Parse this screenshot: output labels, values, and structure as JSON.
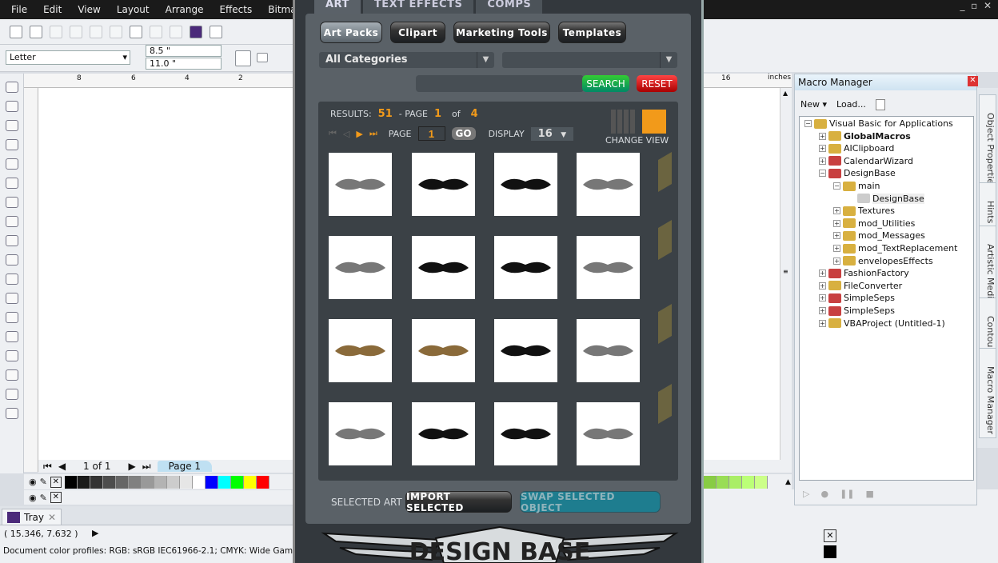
{
  "app": {
    "menu": [
      "File",
      "Edit",
      "View",
      "Layout",
      "Arrange",
      "Effects",
      "Bitmaps"
    ],
    "paper_size": "Letter",
    "width": "8.5 \"",
    "height": "11.0 \"",
    "ruler_ticks": [
      "8",
      "6",
      "4",
      "2"
    ],
    "ruler_ticks_right": [
      "16"
    ],
    "ruler_unit": "inches",
    "page_counter": "1 of 1",
    "page_tab": "Page 1",
    "tray_label": "Tray",
    "coordinates": "( 15.346, 7.632 )",
    "status_profiles": "Document color profiles: RGB: sRGB IEC61966-2.1; CMYK: Wide Gamut CMYK",
    "palette": [
      "#000000",
      "#1a1a1a",
      "#333333",
      "#4d4d4d",
      "#666666",
      "#808080",
      "#999999",
      "#b3b3b3",
      "#cccccc",
      "#e6e6e6",
      "#ffffff",
      "#0000ff",
      "#00ffff",
      "#00ff00",
      "#ffff00",
      "#ff0000"
    ],
    "palette_right": [
      "#88cc44",
      "#99dd55",
      "#aaee66",
      "#bbff77",
      "#ccff88"
    ]
  },
  "dialog": {
    "tabs": [
      "ART",
      "TEXT EFFECTS",
      "COMPS"
    ],
    "categories": [
      "Art Packs",
      "Clipart",
      "Marketing Tools",
      "Templates"
    ],
    "category_select": "All Categories",
    "sub_select": "",
    "search_value": "",
    "search_label": "SEARCH",
    "reset_label": "RESET",
    "results_label": "RESULTS:",
    "results_count": "51",
    "page_label_1": "- PAGE",
    "page_current": "1",
    "of_label": "of",
    "page_total": "4",
    "page_label": "PAGE",
    "page_input": "1",
    "go_label": "GO",
    "display_label": "DISPLAY",
    "display_value": "16",
    "change_view_label": "CHANGE VIEW",
    "accent": "#f29a1a",
    "thumbnails": [
      "tribal-wings",
      "winged-banner",
      "crest-scroll",
      "wings",
      "shield-wings",
      "dragon-crest",
      "grunge-banner",
      "tribal-fleur",
      "ribbon-simple",
      "ribbon-brown",
      "sea-creatures",
      "nautical",
      "flourish-snake",
      "jets",
      "planes",
      "tribal-flourish"
    ],
    "selected_art_label": "SELECTED ART",
    "import_label": "IMPORT SELECTED",
    "swap_label": "SWAP SELECTED OBJECT",
    "logo_text": "DESIGN BASE"
  },
  "macro_manager": {
    "title": "Macro Manager",
    "new_label": "New",
    "load_label": "Load...",
    "tree": [
      {
        "label": "Visual Basic for Applications",
        "level": 0,
        "expanded": true
      },
      {
        "label": "GlobalMacros",
        "level": 1,
        "bold": true
      },
      {
        "label": "AIClipboard",
        "level": 1
      },
      {
        "label": "CalendarWizard",
        "level": 1
      },
      {
        "label": "DesignBase",
        "level": 1,
        "expanded": true
      },
      {
        "label": "main",
        "level": 2,
        "expanded": true
      },
      {
        "label": "DesignBase",
        "level": 3
      },
      {
        "label": "Textures",
        "level": 2
      },
      {
        "label": "mod_Utilities",
        "level": 2
      },
      {
        "label": "mod_Messages",
        "level": 2
      },
      {
        "label": "mod_TextReplacement",
        "level": 2
      },
      {
        "label": "envelopesEffects",
        "level": 2
      },
      {
        "label": "FashionFactory",
        "level": 1
      },
      {
        "label": "FileConverter",
        "level": 1
      },
      {
        "label": "SimpleSeps",
        "level": 1
      },
      {
        "label": "SimpleSeps",
        "level": 1
      },
      {
        "label": "VBAProject (Untitled-1)",
        "level": 1
      }
    ],
    "side_tabs": [
      "Object Properties",
      "Hints",
      "Artistic Media",
      "Contour",
      "Macro Manager"
    ]
  }
}
